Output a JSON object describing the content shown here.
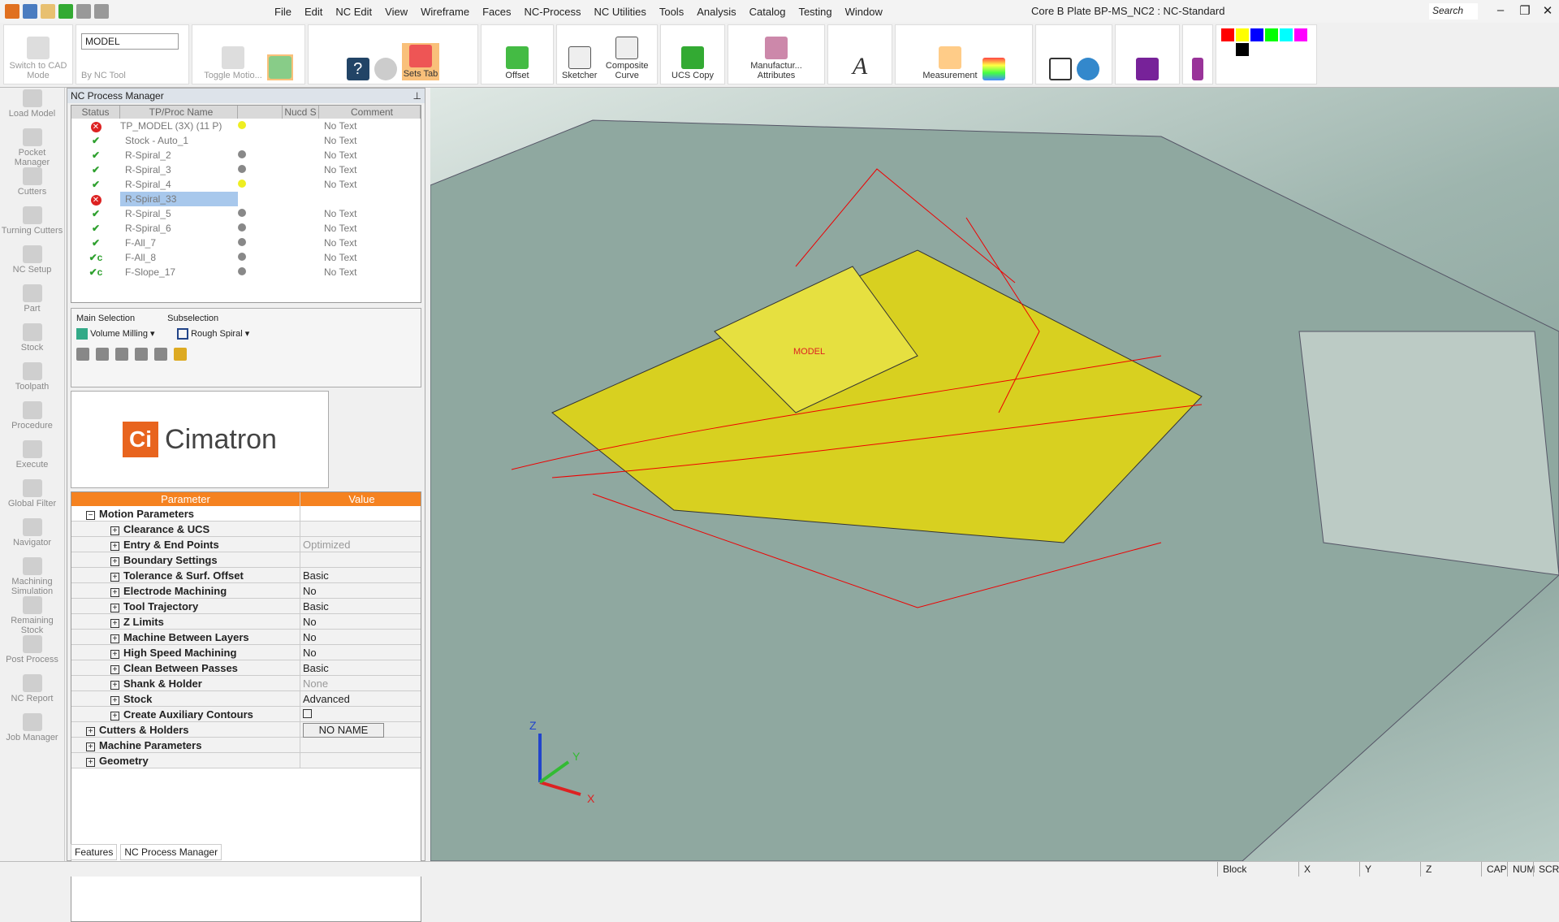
{
  "menubar": {
    "items": [
      "File",
      "Edit",
      "NC Edit",
      "View",
      "Wireframe",
      "Faces",
      "NC-Process",
      "NC Utilities",
      "Tools",
      "Analysis",
      "Catalog",
      "Testing",
      "Window"
    ],
    "title": "Core B Plate BP-MS_NC2 : NC-Standard",
    "search": "Search"
  },
  "toolbar": {
    "switch_cad": "Switch to CAD Mode",
    "model_select": "MODEL",
    "by_nc_tool": "By NC Tool",
    "toggle_motion": "Toggle Motio...",
    "sets_tab": "Sets Tab",
    "offset": "Offset",
    "sketcher": "Sketcher",
    "composite_curve": "Composite Curve",
    "ucs_copy": "UCS Copy",
    "manufacturing_attributes": "Manufactur... Attributes",
    "measurement": "Measurement",
    "palette": [
      "#ff0000",
      "#ffff00",
      "#0000ff",
      "#00ff00",
      "#00ffff",
      "#ff00ff",
      "#ffffff",
      "#000000"
    ]
  },
  "sidebar": {
    "items": [
      "Load Model",
      "Pocket Manager",
      "Cutters",
      "Turning Cutters",
      "NC Setup",
      "Part",
      "Stock",
      "Toolpath",
      "Procedure",
      "Execute",
      "Global Filter",
      "Navigator",
      "Machining Simulation",
      "Remaining Stock",
      "Post Process",
      "NC Report",
      "Job Manager"
    ]
  },
  "panel": {
    "title": "NC Process Manager",
    "columns": [
      "Status",
      "TP/Proc Name",
      "",
      "Nucd",
      "S",
      "Comment"
    ],
    "rows": [
      {
        "status": "error",
        "name": "TP_MODEL (3X) (11 P)",
        "bulb": "yellow",
        "comment": "No Text"
      },
      {
        "status": "ok",
        "name": "Stock - Auto_1",
        "bulb": "",
        "comment": "No Text"
      },
      {
        "status": "ok",
        "name": "R-Spiral_2",
        "bulb": "gray",
        "comment": "No Text"
      },
      {
        "status": "ok",
        "name": "R-Spiral_3",
        "bulb": "gray",
        "comment": "No Text"
      },
      {
        "status": "ok",
        "name": "R-Spiral_4",
        "bulb": "yellow",
        "comment": "No Text"
      },
      {
        "status": "error",
        "name": "R-Spiral_33",
        "bulb": "",
        "comment": ""
      },
      {
        "status": "ok",
        "name": "R-Spiral_5",
        "bulb": "gray",
        "comment": "No Text"
      },
      {
        "status": "ok",
        "name": "R-Spiral_6",
        "bulb": "gray",
        "comment": "No Text"
      },
      {
        "status": "ok",
        "name": "F-All_7",
        "bulb": "gray",
        "comment": "No Text"
      },
      {
        "status": "ok-c",
        "name": "F-All_8",
        "bulb": "gray",
        "comment": "No Text"
      },
      {
        "status": "ok-c",
        "name": "F-Slope_17",
        "bulb": "gray",
        "comment": "No Text"
      }
    ],
    "main_selection_label": "Main Selection",
    "main_selection": "Volume Milling",
    "subselection_label": "Subselection",
    "subselection": "Rough Spiral",
    "logo_text": "Cimatron",
    "logo_mark": "Ci",
    "param_header": "Parameter",
    "value_header": "Value",
    "params": [
      {
        "name": "Motion Parameters",
        "value": "",
        "level": 0,
        "expanded": true
      },
      {
        "name": "Clearance & UCS",
        "value": "",
        "level": 1
      },
      {
        "name": "Entry & End Points",
        "value": "Optimized",
        "level": 1,
        "dim": true
      },
      {
        "name": "Boundary Settings",
        "value": "",
        "level": 1
      },
      {
        "name": "Tolerance & Surf. Offset",
        "value": "Basic",
        "level": 1
      },
      {
        "name": "Electrode Machining",
        "value": "No",
        "level": 1
      },
      {
        "name": "Tool Trajectory",
        "value": "Basic",
        "level": 1
      },
      {
        "name": "Z Limits",
        "value": "No",
        "level": 1
      },
      {
        "name": "Machine Between Layers",
        "value": "No",
        "level": 1
      },
      {
        "name": "High Speed Machining",
        "value": "No",
        "level": 1
      },
      {
        "name": "Clean Between Passes",
        "value": "Basic",
        "level": 1
      },
      {
        "name": "Shank & Holder",
        "value": "None",
        "level": 1,
        "dim": true
      },
      {
        "name": "Stock",
        "value": "Advanced",
        "level": 1
      },
      {
        "name": "Create Auxiliary Contours",
        "value": "",
        "level": 1,
        "checkbox": true
      },
      {
        "name": "Cutters & Holders",
        "value": "NO NAME",
        "level": 0,
        "button": true
      },
      {
        "name": "Machine Parameters",
        "value": "",
        "level": 0
      },
      {
        "name": "Geometry",
        "value": "",
        "level": 0
      }
    ],
    "tabs": [
      "Features",
      "NC Process Manager"
    ]
  },
  "viewport": {
    "model_label": "MODEL",
    "axes": [
      "X",
      "Y",
      "Z"
    ]
  },
  "statusbar": {
    "items": [
      "Block",
      "X",
      "Y",
      "Z",
      "CAP",
      "NUM",
      "SCRL"
    ]
  }
}
